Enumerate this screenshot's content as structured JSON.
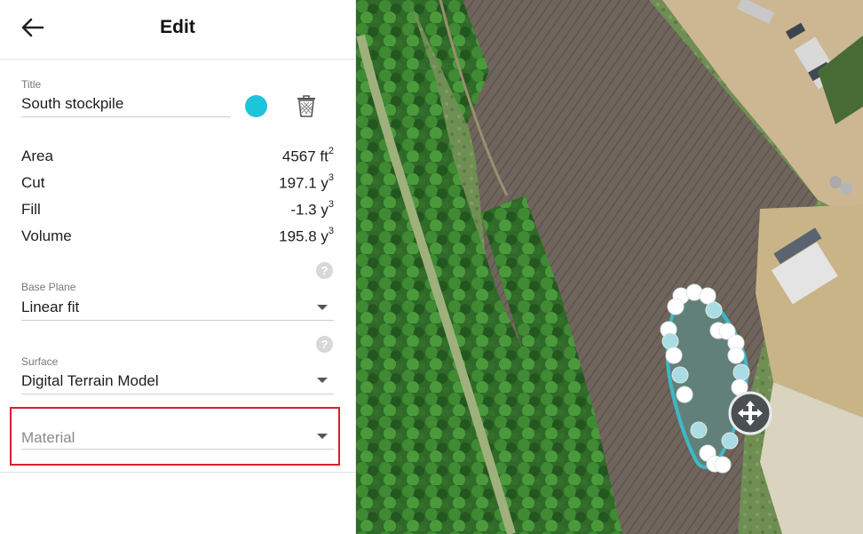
{
  "header": {
    "title": "Edit",
    "back_icon": "arrow-left-icon"
  },
  "form": {
    "title_label": "Title",
    "title_value": "South stockpile",
    "color": "#1ec3dc",
    "delete_icon": "trash-icon"
  },
  "stats": [
    {
      "name": "Area",
      "value": "4567 ft",
      "unit_exp": "2"
    },
    {
      "name": "Cut",
      "value": "197.1 y",
      "unit_exp": "3"
    },
    {
      "name": "Fill",
      "value": "-1.3 y",
      "unit_exp": "3"
    },
    {
      "name": "Volume",
      "value": "195.8 y",
      "unit_exp": "3"
    }
  ],
  "base_plane": {
    "label": "Base Plane",
    "value": "Linear fit",
    "help": "?"
  },
  "surface": {
    "label": "Surface",
    "value": "Digital Terrain Model",
    "help": "?"
  },
  "material": {
    "placeholder": "Material"
  },
  "map": {
    "move_icon": "move-arrows-icon",
    "polygon_color": "#3fb8c6"
  }
}
